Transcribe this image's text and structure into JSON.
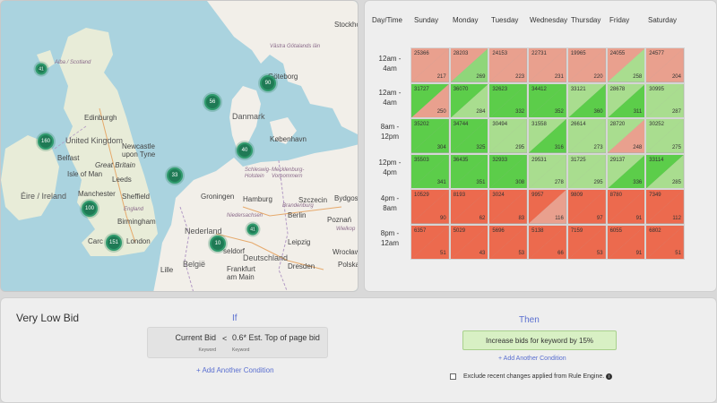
{
  "map": {
    "labels": {
      "stockholm": "Stockho",
      "goteborg": "Göteborg",
      "alba": "Alba / Scotland",
      "edinburgh": "Edinburgh",
      "danmark": "Danmark",
      "kobenhavn": "København",
      "united_kingdom": "United Kingdom",
      "newcastle": "Newcastle\nupon Tyne",
      "belfast": "Belfast",
      "great_britain": "Great Britain",
      "isle_of_man": "Isle of Man",
      "leeds": "Leeds",
      "eire": "Éire / Ireland",
      "manchester": "Manchester",
      "sheffield": "Sheffield",
      "england": "England",
      "birmingham": "Birmingham",
      "london": "London",
      "cardiff": "Carc",
      "groningen": "Groningen",
      "hamburg": "Hamburg",
      "szczecin": "Szczecin",
      "bydgoszcz": "Bydgosz",
      "nederland": "Nederland",
      "berlin": "Berlin",
      "poznan": "Poznań",
      "wielko": "Wielkop",
      "dusseldorf": "Dus",
      "duseldorf_tail": "seldorf",
      "leipzig": "Leipzig",
      "deutschland": "Deutschland",
      "wroclaw": "Wrocław",
      "lille": "Lille",
      "belgie": "België",
      "frankfurt": "Frankfurt\nam Main",
      "dresden": "Dresden",
      "polska": "Polska",
      "mecklenburg": "Mecklenburg-\nVorpommern",
      "niedersachsen": "Niedersachsen",
      "nederland_region": "Nederland",
      "schleswig": "Schleswig-\nHolstein",
      "norway_region": "Västra Götalands län",
      "brandenburg": "Brandenburg"
    },
    "markers": [
      {
        "label": "41",
        "name": "marker-41-scotland"
      },
      {
        "label": "90",
        "name": "marker-90-goteborg"
      },
      {
        "label": "56",
        "name": "marker-56-skagerrak"
      },
      {
        "label": "160",
        "name": "marker-160-belfast"
      },
      {
        "label": "40",
        "name": "marker-40-denmark"
      },
      {
        "label": "33",
        "name": "marker-33-north-sea"
      },
      {
        "label": "100",
        "name": "marker-100-wales"
      },
      {
        "label": "151",
        "name": "marker-151-london"
      },
      {
        "label": "41",
        "name": "marker-41-germany"
      },
      {
        "label": "10",
        "name": "marker-10-dusseldorf"
      }
    ]
  },
  "heatmap": {
    "corner_label": "Day/Time",
    "days": [
      "Sunday",
      "Monday",
      "Tuesday",
      "Wednesday",
      "Thursday",
      "Friday",
      "Saturday"
    ],
    "time_slots": [
      "12am -\n4am",
      "12am -\n4am",
      "8am -\n12pm",
      "12pm -\n4pm",
      "4pm -\n8am",
      "8pm -\n12am"
    ],
    "rows": [
      [
        {
          "v1": "25366",
          "v2": "217",
          "top": "#e9a08e",
          "bottom": "#e9a08e"
        },
        {
          "v1": "28203",
          "v2": "269",
          "top": "#e9a08e",
          "bottom": "#8fd67a"
        },
        {
          "v1": "24153",
          "v2": "223",
          "top": "#e9a08e",
          "bottom": "#e9a08e"
        },
        {
          "v1": "22731",
          "v2": "231",
          "top": "#e9a08e",
          "bottom": "#e9a08e"
        },
        {
          "v1": "19965",
          "v2": "220",
          "top": "#e9a08e",
          "bottom": "#e9a08e"
        },
        {
          "v1": "24055",
          "v2": "258",
          "top": "#e9a08e",
          "bottom": "#a9dd8f"
        },
        {
          "v1": "24577",
          "v2": "204",
          "top": "#e9a08e",
          "bottom": "#e9a08e"
        }
      ],
      [
        {
          "v1": "31727",
          "v2": "250",
          "top": "#5ccd4a",
          "bottom": "#e9a08e"
        },
        {
          "v1": "36070",
          "v2": "284",
          "top": "#5ccd4a",
          "bottom": "#a9dd8f"
        },
        {
          "v1": "32623",
          "v2": "332",
          "top": "#5ccd4a",
          "bottom": "#5ccd4a"
        },
        {
          "v1": "34412",
          "v2": "352",
          "top": "#5ccd4a",
          "bottom": "#5ccd4a"
        },
        {
          "v1": "33121",
          "v2": "360",
          "top": "#a9dd8f",
          "bottom": "#5ccd4a"
        },
        {
          "v1": "28678",
          "v2": "311",
          "top": "#a9dd8f",
          "bottom": "#5ccd4a"
        },
        {
          "v1": "30995",
          "v2": "287",
          "top": "#a9dd8f",
          "bottom": "#a9dd8f"
        }
      ],
      [
        {
          "v1": "35202",
          "v2": "304",
          "top": "#5ccd4a",
          "bottom": "#5ccd4a"
        },
        {
          "v1": "34744",
          "v2": "325",
          "top": "#5ccd4a",
          "bottom": "#5ccd4a"
        },
        {
          "v1": "30494",
          "v2": "295",
          "top": "#a9dd8f",
          "bottom": "#a9dd8f"
        },
        {
          "v1": "31558",
          "v2": "316",
          "top": "#a9dd8f",
          "bottom": "#5ccd4a"
        },
        {
          "v1": "26614",
          "v2": "273",
          "top": "#a9dd8f",
          "bottom": "#a9dd8f"
        },
        {
          "v1": "28720",
          "v2": "248",
          "top": "#a9dd8f",
          "bottom": "#e9a08e"
        },
        {
          "v1": "30252",
          "v2": "275",
          "top": "#a9dd8f",
          "bottom": "#a9dd8f"
        }
      ],
      [
        {
          "v1": "35503",
          "v2": "341",
          "top": "#5ccd4a",
          "bottom": "#5ccd4a"
        },
        {
          "v1": "36435",
          "v2": "351",
          "top": "#5ccd4a",
          "bottom": "#5ccd4a"
        },
        {
          "v1": "32933",
          "v2": "308",
          "top": "#5ccd4a",
          "bottom": "#5ccd4a"
        },
        {
          "v1": "29531",
          "v2": "278",
          "top": "#a9dd8f",
          "bottom": "#a9dd8f"
        },
        {
          "v1": "31725",
          "v2": "295",
          "top": "#a9dd8f",
          "bottom": "#a9dd8f"
        },
        {
          "v1": "29137",
          "v2": "336",
          "top": "#a9dd8f",
          "bottom": "#5ccd4a"
        },
        {
          "v1": "33114",
          "v2": "285",
          "top": "#5ccd4a",
          "bottom": "#a9dd8f"
        }
      ],
      [
        {
          "v1": "10529",
          "v2": "90",
          "top": "#ec6a4e",
          "bottom": "#ec6a4e"
        },
        {
          "v1": "8193",
          "v2": "62",
          "top": "#ec6a4e",
          "bottom": "#ec6a4e"
        },
        {
          "v1": "3024",
          "v2": "83",
          "top": "#ec6a4e",
          "bottom": "#ec6a4e"
        },
        {
          "v1": "9957",
          "v2": "116",
          "top": "#ec6a4e",
          "bottom": "#e9a08e"
        },
        {
          "v1": "9809",
          "v2": "97",
          "top": "#ec6a4e",
          "bottom": "#ec6a4e"
        },
        {
          "v1": "8780",
          "v2": "91",
          "top": "#ec6a4e",
          "bottom": "#ec6a4e"
        },
        {
          "v1": "7349",
          "v2": "112",
          "top": "#ec6a4e",
          "bottom": "#ec6a4e"
        }
      ],
      [
        {
          "v1": "6357",
          "v2": "51",
          "top": "#ec6a4e",
          "bottom": "#ec6a4e"
        },
        {
          "v1": "5029",
          "v2": "43",
          "top": "#ec6a4e",
          "bottom": "#ec6a4e"
        },
        {
          "v1": "5696",
          "v2": "53",
          "top": "#ec6a4e",
          "bottom": "#ec6a4e"
        },
        {
          "v1": "5138",
          "v2": "66",
          "top": "#ec6a4e",
          "bottom": "#ec6a4e"
        },
        {
          "v1": "7159",
          "v2": "53",
          "top": "#ec6a4e",
          "bottom": "#ec6a4e"
        },
        {
          "v1": "6055",
          "v2": "91",
          "top": "#ec6a4e",
          "bottom": "#ec6a4e"
        },
        {
          "v1": "6802",
          "v2": "51",
          "top": "#ec6a4e",
          "bottom": "#ec6a4e"
        }
      ]
    ]
  },
  "rule": {
    "title": "Very Low Bid",
    "if_label": "If",
    "then_label": "Then",
    "condition": {
      "field": "Current Bid",
      "field_sub": "Keyword",
      "operator": "<",
      "value": "0.6* Est. Top of page bid",
      "value_sub": "Keyword"
    },
    "add_condition_if": "+ Add Another Condition",
    "action": "Increase bids for keyword by 15%",
    "add_condition_then": "+ Add Another Condition",
    "exclude_label": "Exclude recent changes applied from Rule Engine.",
    "info_icon": "i"
  }
}
